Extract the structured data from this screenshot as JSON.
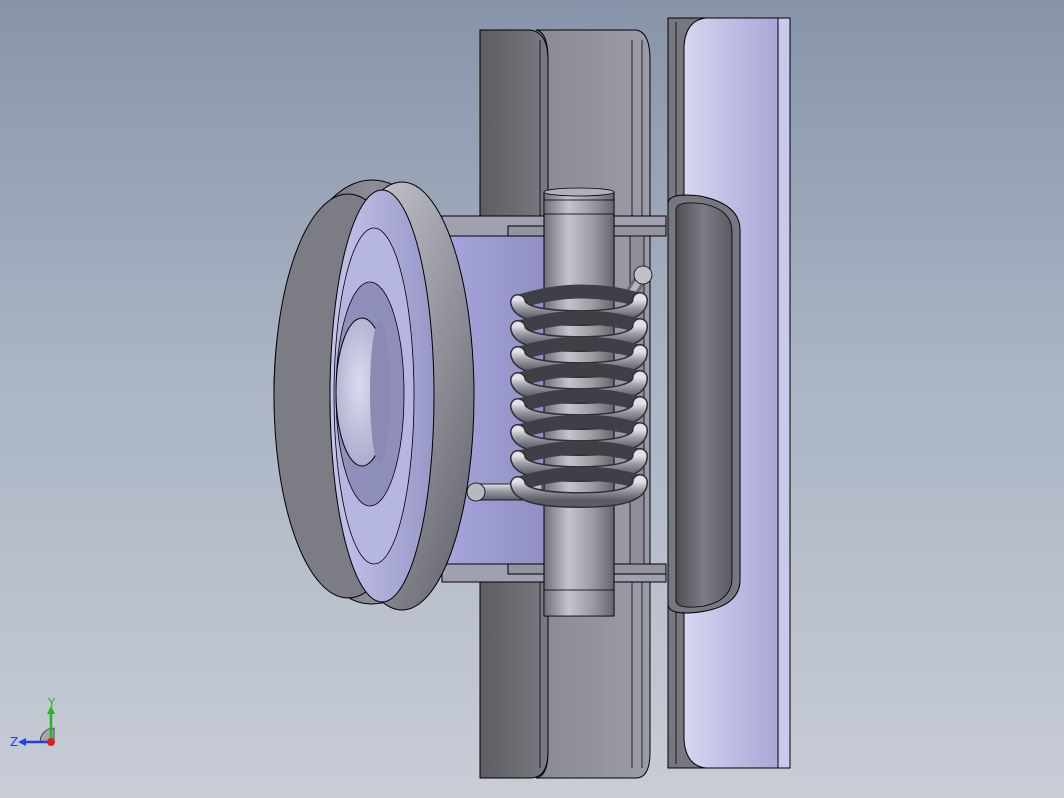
{
  "triad": {
    "x_label": "",
    "y_label": "Y",
    "z_label": "Z"
  },
  "colors": {
    "background_top": "#8794a9",
    "background_bottom": "#c8cdd6",
    "part_face": "#8a8a96",
    "part_edge": "#000000",
    "highlight_face": "#b8b8e0",
    "axis_y": "#1fb81f",
    "axis_z": "#2040e0",
    "axis_x": "#e02020"
  },
  "parts": [
    "wheel",
    "spring",
    "pin",
    "bracket",
    "back-plate",
    "mount-plate",
    "sleeve"
  ]
}
